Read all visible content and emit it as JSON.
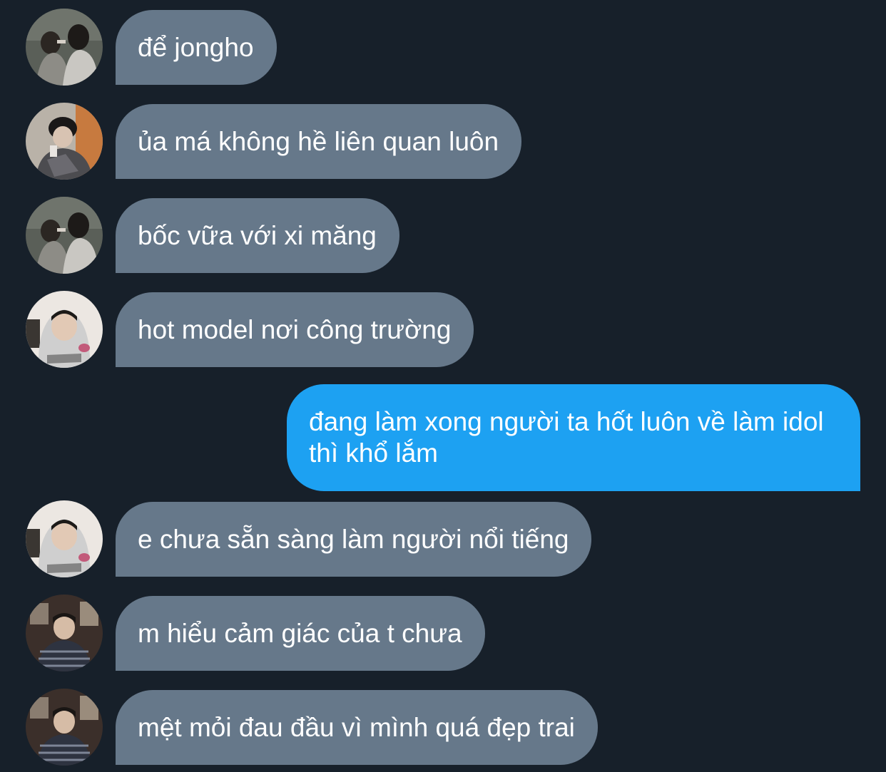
{
  "colors": {
    "background": "#17202a",
    "incoming_bubble": "#66788a",
    "outgoing_bubble": "#1da1f2",
    "text": "#ffffff"
  },
  "messages": [
    {
      "direction": "incoming",
      "avatar": "avatar-two-people-photo",
      "text": "để jongho"
    },
    {
      "direction": "incoming",
      "avatar": "avatar-cap-boy-photo",
      "text": "ủa má không hề liên quan luôn"
    },
    {
      "direction": "incoming",
      "avatar": "avatar-two-people-photo",
      "text": "bốc vữa với xi măng"
    },
    {
      "direction": "incoming",
      "avatar": "avatar-hoodie-boy-photo",
      "text": "hot model nơi công trường"
    },
    {
      "direction": "outgoing",
      "text": "đang làm xong người ta hốt luôn về làm idol thì khổ lắm"
    },
    {
      "direction": "incoming",
      "avatar": "avatar-hoodie-boy-photo",
      "text": "e chưa sẵn sàng làm người nổi tiếng"
    },
    {
      "direction": "incoming",
      "avatar": "avatar-striped-sweater-photo",
      "text": "m hiểu cảm giác của t chưa"
    },
    {
      "direction": "incoming",
      "avatar": "avatar-striped-sweater-photo",
      "text": "mệt mỏi đau đầu vì mình quá đẹp trai"
    }
  ]
}
